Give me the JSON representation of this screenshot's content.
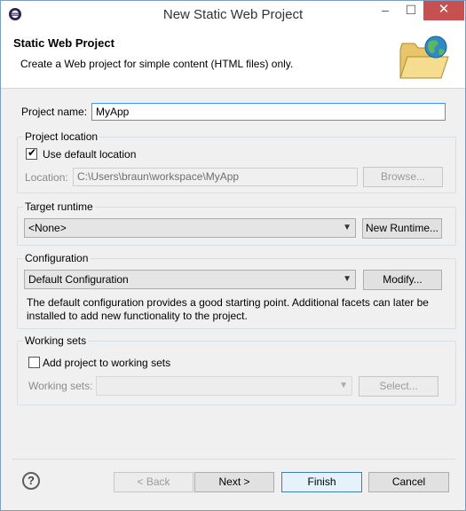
{
  "window": {
    "title": "New Static Web Project",
    "minimize": "–",
    "maximize": "☐",
    "close": "✕"
  },
  "banner": {
    "title": "Static Web Project",
    "description": "Create a Web project for simple content (HTML files) only."
  },
  "project_name": {
    "label": "Project name:",
    "value": "MyApp"
  },
  "project_location": {
    "group_title": "Project location",
    "use_default_label": "Use default location",
    "use_default_checked": true,
    "location_label": "Location:",
    "location_value": "C:\\Users\\braun\\workspace\\MyApp",
    "browse_label": "Browse..."
  },
  "target_runtime": {
    "group_title": "Target runtime",
    "selected": "<None>",
    "new_runtime_label": "New Runtime..."
  },
  "configuration": {
    "group_title": "Configuration",
    "selected": "Default Configuration",
    "modify_label": "Modify...",
    "description_line1": "The default configuration provides a good starting point. Additional facets can later be",
    "description_line2": "installed to add new functionality to the project."
  },
  "working_sets": {
    "group_title": "Working sets",
    "add_label": "Add project to working sets",
    "add_checked": false,
    "sets_label": "Working sets:",
    "sets_value": "",
    "select_label": "Select..."
  },
  "footer": {
    "help": "?",
    "back_label": "< Back",
    "next_label": "Next >",
    "finish_label": "Finish",
    "cancel_label": "Cancel"
  }
}
